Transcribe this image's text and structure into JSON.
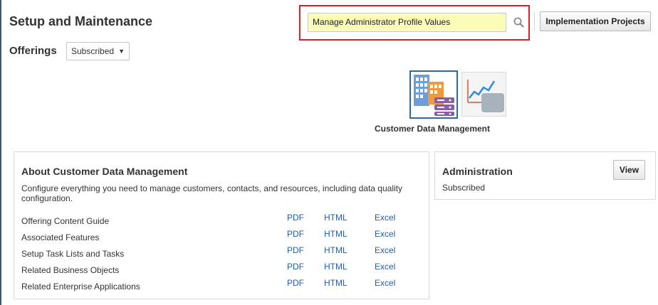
{
  "header": {
    "title": "Setup and Maintenance",
    "search_value": "Manage Administrator Profile Values",
    "implementation_projects_label": "Implementation Projects"
  },
  "offerings": {
    "label": "Offerings",
    "filter_selected": "Subscribed"
  },
  "tiles": [
    {
      "caption": "Customer Data Management",
      "icon": "buildings-database-icon",
      "selected": true
    },
    {
      "caption": "",
      "icon": "analytics-chart-icon",
      "selected": false
    }
  ],
  "about": {
    "title": "About Customer Data Management",
    "description": "Configure everything you need to manage customers, contacts, and resources, including data quality configuration.",
    "rows": [
      {
        "label": "Offering Content Guide",
        "pdf": "PDF",
        "html": "HTML",
        "excel": "Excel"
      },
      {
        "label": "Associated Features",
        "pdf": "PDF",
        "html": "HTML",
        "excel": "Excel"
      },
      {
        "label": "Setup Task Lists and Tasks",
        "pdf": "PDF",
        "html": "HTML",
        "excel": "Excel"
      },
      {
        "label": "Related Business Objects",
        "pdf": "PDF",
        "html": "HTML",
        "excel": "Excel"
      },
      {
        "label": "Related Enterprise Applications",
        "pdf": "PDF",
        "html": "HTML",
        "excel": "Excel"
      }
    ]
  },
  "administration": {
    "title": "Administration",
    "status": "Subscribed",
    "view_label": "View"
  },
  "colors": {
    "search_highlight": "#d1232a",
    "search_field_bg": "#fbfcb8",
    "link": "#1f5ea8",
    "selected_tile_border": "#2b6aa8"
  }
}
